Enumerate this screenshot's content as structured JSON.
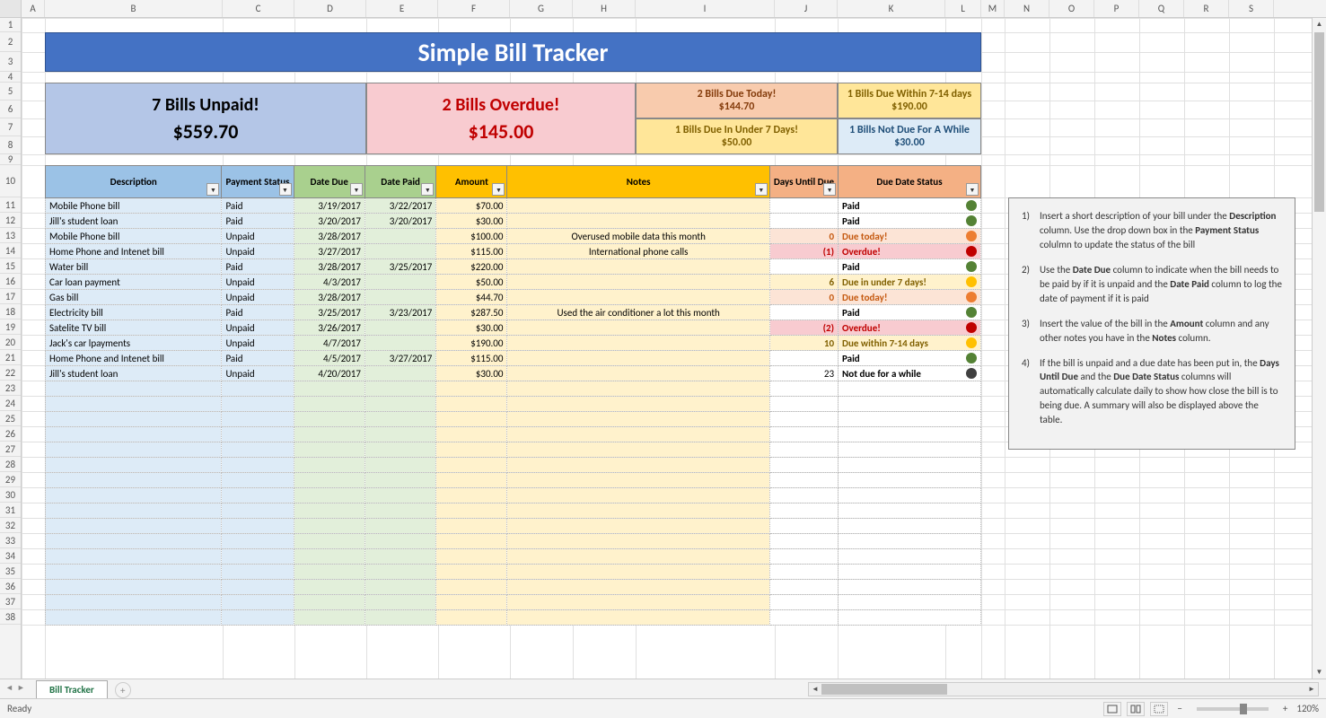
{
  "columns": [
    {
      "l": "A",
      "w": 26
    },
    {
      "l": "B",
      "w": 198
    },
    {
      "l": "C",
      "w": 80
    },
    {
      "l": "D",
      "w": 80
    },
    {
      "l": "E",
      "w": 80
    },
    {
      "l": "F",
      "w": 80
    },
    {
      "l": "G",
      "w": 70
    },
    {
      "l": "H",
      "w": 70
    },
    {
      "l": "I",
      "w": 155
    },
    {
      "l": "J",
      "w": 70
    },
    {
      "l": "K",
      "w": 120
    },
    {
      "l": "L",
      "w": 40
    },
    {
      "l": "M",
      "w": 26
    },
    {
      "l": "N",
      "w": 50
    },
    {
      "l": "O",
      "w": 50
    },
    {
      "l": "P",
      "w": 50
    },
    {
      "l": "Q",
      "w": 50
    },
    {
      "l": "R",
      "w": 50
    },
    {
      "l": "S",
      "w": 50
    }
  ],
  "rows": [
    {
      "n": 1,
      "h": 16
    },
    {
      "n": 2,
      "h": 22
    },
    {
      "n": 3,
      "h": 22
    },
    {
      "n": 4,
      "h": 12
    },
    {
      "n": 5,
      "h": 20
    },
    {
      "n": 6,
      "h": 20
    },
    {
      "n": 7,
      "h": 20
    },
    {
      "n": 8,
      "h": 20
    },
    {
      "n": 9,
      "h": 12
    },
    {
      "n": 10,
      "h": 36
    },
    {
      "n": 11,
      "h": 17
    },
    {
      "n": 12,
      "h": 17
    },
    {
      "n": 13,
      "h": 17
    },
    {
      "n": 14,
      "h": 17
    },
    {
      "n": 15,
      "h": 17
    },
    {
      "n": 16,
      "h": 17
    },
    {
      "n": 17,
      "h": 17
    },
    {
      "n": 18,
      "h": 17
    },
    {
      "n": 19,
      "h": 17
    },
    {
      "n": 20,
      "h": 17
    },
    {
      "n": 21,
      "h": 17
    },
    {
      "n": 22,
      "h": 17
    },
    {
      "n": 23,
      "h": 17
    },
    {
      "n": 24,
      "h": 17
    },
    {
      "n": 25,
      "h": 17
    },
    {
      "n": 26,
      "h": 17
    },
    {
      "n": 27,
      "h": 17
    },
    {
      "n": 28,
      "h": 17
    },
    {
      "n": 29,
      "h": 17
    },
    {
      "n": 30,
      "h": 17
    },
    {
      "n": 31,
      "h": 17
    },
    {
      "n": 32,
      "h": 17
    },
    {
      "n": 33,
      "h": 17
    },
    {
      "n": 34,
      "h": 17
    },
    {
      "n": 35,
      "h": 17
    },
    {
      "n": 36,
      "h": 17
    },
    {
      "n": 37,
      "h": 17
    },
    {
      "n": 38,
      "h": 17
    }
  ],
  "title": "Simple Bill Tracker",
  "summary": {
    "unpaid": {
      "l1": "7 Bills Unpaid!",
      "l2": "$559.70",
      "bg": "#b4c6e7",
      "fg": "#000"
    },
    "overdue": {
      "l1": "2 Bills Overdue!",
      "l2": "$145.00",
      "bg": "#f8cbd0",
      "fg": "#c00000"
    },
    "due_today": {
      "l1": "2 Bills Due Today!",
      "l2": "$144.70",
      "bg": "#f8cbad",
      "fg": "#843c0c"
    },
    "due_7": {
      "l1": "1 Bills Due In Under 7 Days!",
      "l2": "$50.00",
      "bg": "#ffe699",
      "fg": "#806000"
    },
    "due_714": {
      "l1": "1 Bills Due Within 7-14 days",
      "l2": "$190.00",
      "bg": "#ffe699",
      "fg": "#806000"
    },
    "not_due": {
      "l1": "1 Bills Not Due For A While",
      "l2": "$30.00",
      "bg": "#ddebf7",
      "fg": "#1f4e78"
    }
  },
  "headers": {
    "desc": "Description",
    "pstatus": "Payment Status",
    "ddue": "Date Due",
    "dpaid": "Date Paid",
    "amount": "Amount",
    "notes": "Notes",
    "days": "Days Until Due",
    "dstatus": "Due Date Status"
  },
  "header_colors": {
    "desc": "#9bc2e6",
    "pstatus": "#9bc2e6",
    "ddue": "#a9d08e",
    "dpaid": "#a9d08e",
    "amount": "#ffc000",
    "notes": "#ffc000",
    "days": "#f4b084",
    "dstatus": "#f4b084"
  },
  "col_bg": {
    "desc": "#ddebf7",
    "pstatus": "#ddebf7",
    "ddue": "#e2efda",
    "dpaid": "#e2efda",
    "amount": "#fff2cc",
    "notes": "#fff2cc",
    "days": "#ffffff",
    "dstatus": "#ffffff",
    "dot": "#ffffff"
  },
  "bills": [
    {
      "desc": "Mobile Phone bill",
      "pstatus": "Paid",
      "ddue": "3/19/2017",
      "dpaid": "3/22/2017",
      "amount": "$70.00",
      "notes": "",
      "days": "",
      "dstatus": "Paid",
      "dot": "#548235",
      "row_bg": ""
    },
    {
      "desc": "Jill's student loan",
      "pstatus": "Paid",
      "ddue": "3/20/2017",
      "dpaid": "3/20/2017",
      "amount": "$30.00",
      "notes": "",
      "days": "",
      "dstatus": "Paid",
      "dot": "#548235",
      "row_bg": ""
    },
    {
      "desc": "Mobile Phone bill",
      "pstatus": "Unpaid",
      "ddue": "3/28/2017",
      "dpaid": "",
      "amount": "$100.00",
      "notes": "Overused mobile data this month",
      "days": "0",
      "dstatus": "Due today!",
      "dot": "#ed7d31",
      "row_bg": "#fce4d6",
      "dstatus_color": "#c55a11"
    },
    {
      "desc": "Home Phone and Intenet bill",
      "pstatus": "Unpaid",
      "ddue": "3/27/2017",
      "dpaid": "",
      "amount": "$115.00",
      "notes": "International phone calls",
      "days": "(1)",
      "dstatus": "Overdue!",
      "dot": "#c00000",
      "row_bg": "#f8cbd0",
      "dstatus_color": "#c00000"
    },
    {
      "desc": "Water bill",
      "pstatus": "Paid",
      "ddue": "3/28/2017",
      "dpaid": "3/25/2017",
      "amount": "$220.00",
      "notes": "",
      "days": "",
      "dstatus": "Paid",
      "dot": "#548235",
      "row_bg": ""
    },
    {
      "desc": "Car loan payment",
      "pstatus": "Unpaid",
      "ddue": "4/3/2017",
      "dpaid": "",
      "amount": "$50.00",
      "notes": "",
      "days": "6",
      "dstatus": "Due in under 7 days!",
      "dot": "#ffc000",
      "row_bg": "#fff2cc",
      "dstatus_color": "#806000"
    },
    {
      "desc": "Gas bill",
      "pstatus": "Unpaid",
      "ddue": "3/28/2017",
      "dpaid": "",
      "amount": "$44.70",
      "notes": "",
      "days": "0",
      "dstatus": "Due today!",
      "dot": "#ed7d31",
      "row_bg": "#fce4d6",
      "dstatus_color": "#c55a11"
    },
    {
      "desc": "Electricity bill",
      "pstatus": "Paid",
      "ddue": "3/25/2017",
      "dpaid": "3/23/2017",
      "amount": "$287.50",
      "notes": "Used the air conditioner a lot this month",
      "days": "",
      "dstatus": "Paid",
      "dot": "#548235",
      "row_bg": ""
    },
    {
      "desc": "Satelite TV bill",
      "pstatus": "Unpaid",
      "ddue": "3/26/2017",
      "dpaid": "",
      "amount": "$30.00",
      "notes": "",
      "days": "(2)",
      "dstatus": "Overdue!",
      "dot": "#c00000",
      "row_bg": "#f8cbd0",
      "dstatus_color": "#c00000"
    },
    {
      "desc": "Jack's car lpayments",
      "pstatus": "Unpaid",
      "ddue": "4/7/2017",
      "dpaid": "",
      "amount": "$190.00",
      "notes": "",
      "days": "10",
      "dstatus": "Due within 7-14 days",
      "dot": "#ffc000",
      "row_bg": "#fff2cc",
      "dstatus_color": "#806000"
    },
    {
      "desc": "Home Phone and Intenet bill",
      "pstatus": "Paid",
      "ddue": "4/5/2017",
      "dpaid": "3/27/2017",
      "amount": "$115.00",
      "notes": "",
      "days": "",
      "dstatus": "Paid",
      "dot": "#548235",
      "row_bg": ""
    },
    {
      "desc": "Jill's student loan",
      "pstatus": "Unpaid",
      "ddue": "4/20/2017",
      "dpaid": "",
      "amount": "$30.00",
      "notes": "",
      "days": "23",
      "dstatus": "Not due for a while",
      "dot": "#404040",
      "row_bg": ""
    }
  ],
  "empty_rows": 16,
  "instructions": [
    "Insert a short description of your bill  under the <b>Description</b> column. Use the drop down box in the <b>Payment Status</b> colulmn to update the status of the bill",
    "Use the <b>Date Due</b>  column to indicate when the bill needs to be paid by if it is unpaid and the <b>Date Paid</b> column to log the date of payment if it is paid",
    "Insert the value of the bill in the <b>Amount</b> column and any other notes you have in the <b>Notes</b> column.",
    "If the bill is unpaid and a due date has been put in, the <b>Days Until Due</b> and the <b>Due Date Status</b> columns will automatically calculate daily to show how close the bill is to being due. A summary will also be displayed above the table."
  ],
  "tab_name": "Bill Tracker",
  "status_ready": "Ready",
  "zoom": "120%"
}
